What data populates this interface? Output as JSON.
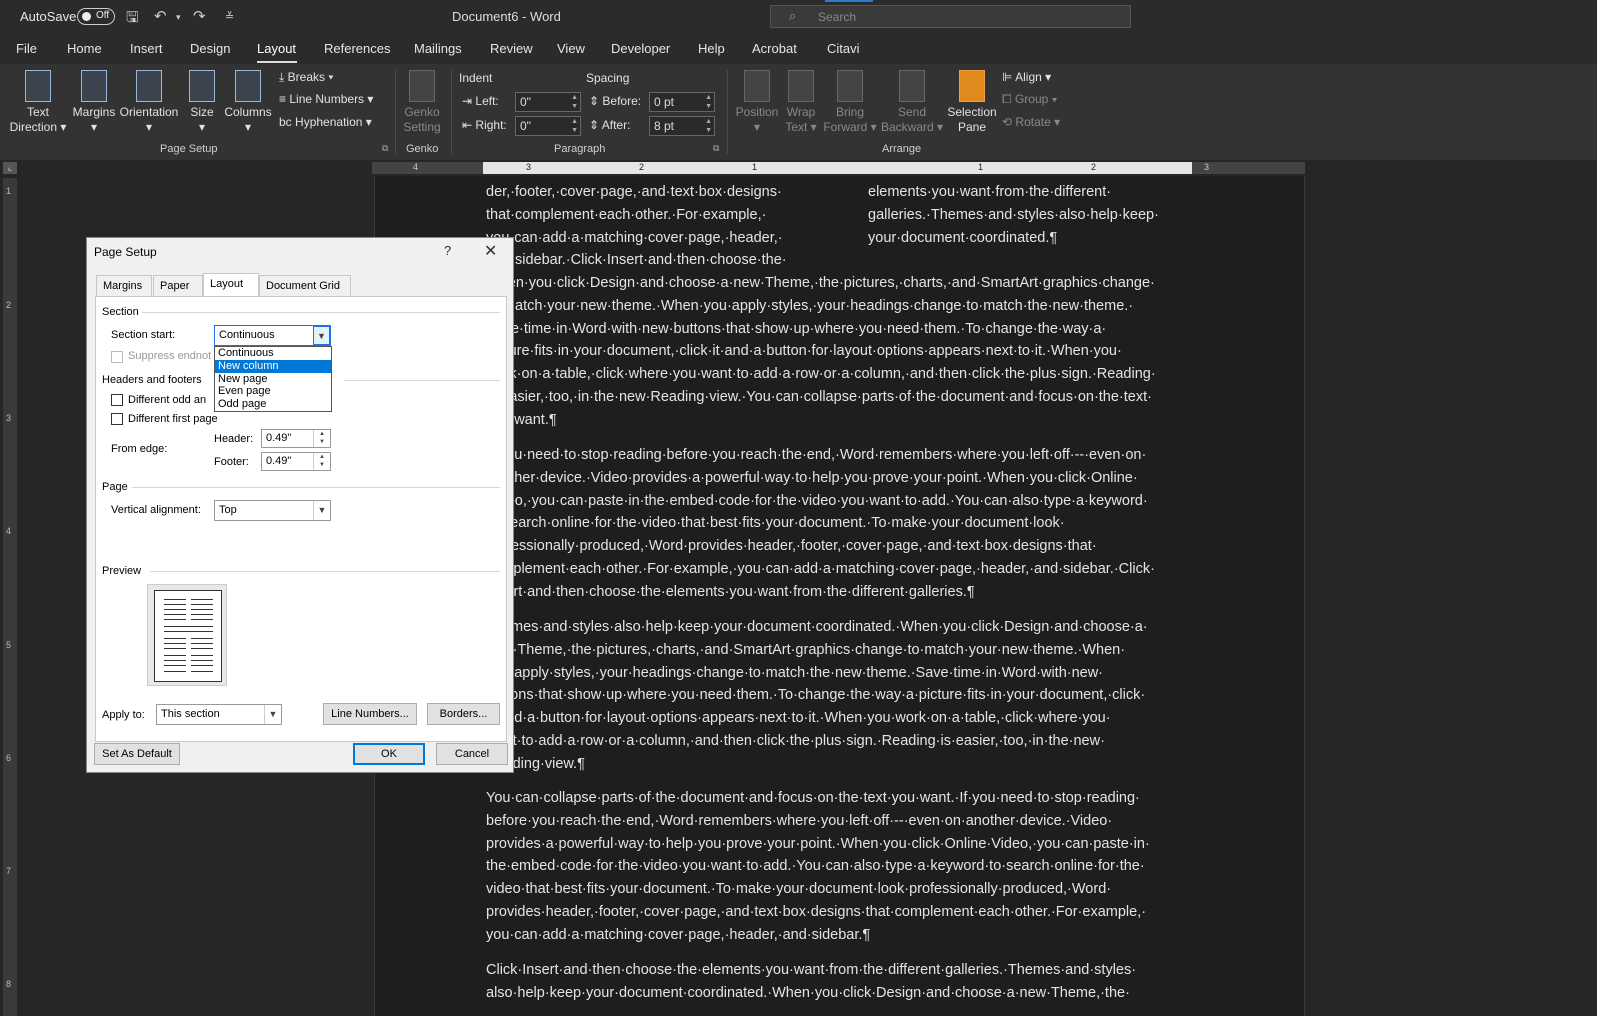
{
  "titlebar": {
    "autosave_label": "AutoSave",
    "autosave_state": "Off",
    "document_title": "Document6 - Word",
    "search_placeholder": "Search"
  },
  "menu": {
    "tabs": [
      "File",
      "Home",
      "Insert",
      "Design",
      "Layout",
      "References",
      "Mailings",
      "Review",
      "View",
      "Developer",
      "Help",
      "Acrobat",
      "Citavi"
    ],
    "active": "Layout"
  },
  "ribbon": {
    "page_setup": {
      "text_direction": [
        "Text",
        "Direction"
      ],
      "margins": "Margins",
      "orientation": "Orientation",
      "size": "Size",
      "columns": "Columns",
      "breaks": "Breaks",
      "line_numbers": "Line Numbers",
      "hyphenation": "Hyphenation",
      "group_label": "Page Setup"
    },
    "genko": {
      "button": [
        "Genko",
        "Setting"
      ],
      "group_label": "Genko"
    },
    "paragraph": {
      "indent_label": "Indent",
      "spacing_label": "Spacing",
      "left_label": "Left:",
      "left_value": "0\"",
      "right_label": "Right:",
      "right_value": "0\"",
      "before_label": "Before:",
      "before_value": "0 pt",
      "after_label": "After:",
      "after_value": "8 pt",
      "group_label": "Paragraph"
    },
    "arrange": {
      "position": "Position",
      "wrap_text": [
        "Wrap",
        "Text"
      ],
      "bring_forward": [
        "Bring",
        "Forward"
      ],
      "send_backward": [
        "Send",
        "Backward"
      ],
      "selection_pane": [
        "Selection",
        "Pane"
      ],
      "align": "Align",
      "group": "Group",
      "rotate": "Rotate",
      "group_label": "Arrange"
    }
  },
  "ruler": {
    "top_numbers": [
      "4",
      "3",
      "2",
      "1",
      "1",
      "2",
      "3"
    ],
    "left_numbers": [
      "1",
      "2",
      "3",
      "4",
      "5",
      "6",
      "7",
      "8"
    ]
  },
  "document": {
    "col_left_lines": [
      "der,·footer,·cover·page,·and·text·box·designs·",
      "that·complement·each·other.·For·example,·",
      "you·can·add·a·matching·cover·page,·header,·",
      "and·sidebar.·Click·Insert·and·then·choose·the·"
    ],
    "col_right_lines": [
      "elements·you·want·from·the·different·",
      "galleries.·Themes·and·styles·also·help·keep·",
      "your·document·coordinated.¶"
    ],
    "para1": [
      "When·you·click·Design·and·choose·a·new·Theme,·the·pictures,·charts,·and·SmartArt·graphics·change·",
      "to·match·your·new·theme.·When·you·apply·styles,·your·headings·change·to·match·the·new·theme.·",
      "Save·time·in·Word·with·new·buttons·that·show·up·where·you·need·them.·To·change·the·way·a·",
      "picture·fits·in·your·document,·click·it·and·a·button·for·layout·options·appears·next·to·it.·When·you·",
      "work·on·a·table,·click·where·you·want·to·add·a·row·or·a·column,·and·then·click·the·plus·sign.·Reading·",
      "is·easier,·too,·in·the·new·Reading·view.·You·can·collapse·parts·of·the·document·and·focus·on·the·text·",
      "you·want.¶"
    ],
    "para2": [
      "If·you·need·to·stop·reading·before·you·reach·the·end,·Word·remembers·where·you·left·off·--·even·on·",
      "another·device.·Video·provides·a·powerful·way·to·help·you·prove·your·point.·When·you·click·Online·",
      "Video,·you·can·paste·in·the·embed·code·for·the·video·you·want·to·add.·You·can·also·type·a·keyword·",
      "to·search·online·for·the·video·that·best·fits·your·document.·To·make·your·document·look·",
      "professionally·produced,·Word·provides·header,·footer,·cover·page,·and·text·box·designs·that·",
      "complement·each·other.·For·example,·you·can·add·a·matching·cover·page,·header,·and·sidebar.·Click·",
      "Insert·and·then·choose·the·elements·you·want·from·the·different·galleries.¶"
    ],
    "para3": [
      "Themes·and·styles·also·help·keep·your·document·coordinated.·When·you·click·Design·and·choose·a·",
      "new·Theme,·the·pictures,·charts,·and·SmartArt·graphics·change·to·match·your·new·theme.·When·",
      "you·apply·styles,·your·headings·change·to·match·the·new·theme.·Save·time·in·Word·with·new·",
      "buttons·that·show·up·where·you·need·them.·To·change·the·way·a·picture·fits·in·your·document,·click·",
      "it·and·a·button·for·layout·options·appears·next·to·it.·When·you·work·on·a·table,·click·where·you·",
      "want·to·add·a·row·or·a·column,·and·then·click·the·plus·sign.·Reading·is·easier,·too,·in·the·new·",
      "Reading·view.¶"
    ],
    "para4": [
      "You·can·collapse·parts·of·the·document·and·focus·on·the·text·you·want.·If·you·need·to·stop·reading·",
      "before·you·reach·the·end,·Word·remembers·where·you·left·off·--·even·on·another·device.·Video·",
      "provides·a·powerful·way·to·help·you·prove·your·point.·When·you·click·Online·Video,·you·can·paste·in·",
      "the·embed·code·for·the·video·you·want·to·add.·You·can·also·type·a·keyword·to·search·online·for·the·",
      "video·that·best·fits·your·document.·To·make·your·document·look·professionally·produced,·Word·",
      "provides·header,·footer,·cover·page,·and·text·box·designs·that·complement·each·other.·For·example,·",
      "you·can·add·a·matching·cover·page,·header,·and·sidebar.¶"
    ],
    "para5": [
      "Click·Insert·and·then·choose·the·elements·you·want·from·the·different·galleries.·Themes·and·styles·",
      "also·help·keep·your·document·coordinated.·When·you·click·Design·and·choose·a·new·Theme,·the·"
    ]
  },
  "dialog": {
    "title": "Page Setup",
    "help": "?",
    "close": "✕",
    "tabs": [
      "Margins",
      "Paper",
      "Layout",
      "Document Grid"
    ],
    "active_tab": "Layout",
    "section_heading": "Section",
    "section_start_label": "Section start:",
    "section_start_value": "Continuous",
    "section_start_options": [
      "Continuous",
      "New column",
      "New page",
      "Even page",
      "Odd page"
    ],
    "section_start_highlighted": "New column",
    "suppress_endnotes_label": "Suppress endnot",
    "headers_footers_heading": "Headers and footers",
    "diff_odd_even_label": "Different odd an",
    "diff_first_page_label": "Different first page",
    "from_edge_label": "From edge:",
    "header_label": "Header:",
    "header_value": "0.49\"",
    "footer_label": "Footer:",
    "footer_value": "0.49\"",
    "page_heading": "Page",
    "vertical_alignment_label": "Vertical alignment:",
    "vertical_alignment_value": "Top",
    "preview_heading": "Preview",
    "apply_to_label": "Apply to:",
    "apply_to_value": "This section",
    "line_numbers_button": "Line Numbers...",
    "borders_button": "Borders...",
    "set_default_button": "Set As Default",
    "ok_button": "OK",
    "cancel_button": "Cancel"
  },
  "colors": {
    "accent": "#2b7cd3",
    "selection": "#0078d7",
    "doc_background": "#1e1e1e"
  }
}
